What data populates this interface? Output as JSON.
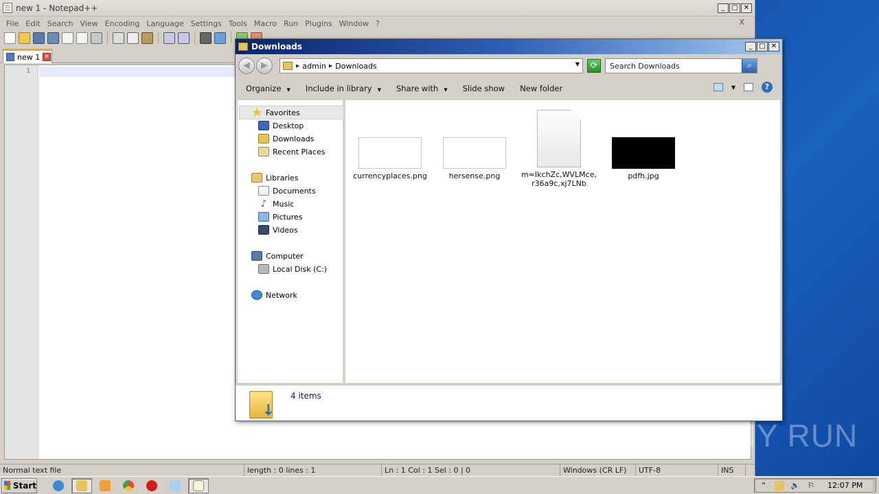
{
  "notepad": {
    "title": "new 1 - Notepad++",
    "caption": {
      "minimize": "_",
      "maximize": "□",
      "close": "✕"
    },
    "menu": [
      "File",
      "Edit",
      "Search",
      "View",
      "Encoding",
      "Language",
      "Settings",
      "Tools",
      "Macro",
      "Run",
      "Plugins",
      "Window",
      "?"
    ],
    "menu_close": "X",
    "tab": {
      "label": "new 1",
      "close": "✕"
    },
    "editor": {
      "line_number": "1"
    },
    "status": {
      "type": "Normal text file",
      "length": "length : 0    lines : 1",
      "position": "Ln : 1    Col : 1    Sel : 0 | 0",
      "eol": "Windows (CR LF)",
      "encoding": "UTF-8",
      "mode": "INS"
    }
  },
  "explorer": {
    "title": "Downloads",
    "caption": {
      "minimize": "_",
      "maximize": "□",
      "close": "✕"
    },
    "nav": {
      "back": "◀",
      "forward": "▶"
    },
    "breadcrumb": [
      "admin",
      "Downloads"
    ],
    "search_placeholder": "Search Downloads",
    "commands": {
      "organize": "Organize",
      "include_in_library": "Include in library",
      "share_with": "Share with",
      "slide_show": "Slide show",
      "new_folder": "New folder"
    },
    "nav_pane": {
      "favorites": "Favorites",
      "desktop": "Desktop",
      "downloads": "Downloads",
      "recent_places": "Recent Places",
      "libraries": "Libraries",
      "documents": "Documents",
      "music": "Music",
      "pictures": "Pictures",
      "videos": "Videos",
      "computer": "Computer",
      "local_disk": "Local Disk (C:)",
      "network": "Network"
    },
    "files": [
      {
        "name": "currencyplaces.png"
      },
      {
        "name": "hersense.png"
      },
      {
        "name_line1": "m=IkchZc,WVLMce,",
        "name_line2": "r36a9c,xj7LNb"
      },
      {
        "name": "pdfh.jpg"
      }
    ],
    "item_count": "4 items"
  },
  "watermark": "ANY RUN",
  "taskbar": {
    "start": "Start",
    "clock": "12:07 PM"
  },
  "colors": {
    "desktop": "#1a5cb8",
    "window_face": "#d4d0c8",
    "explorer_title": "#0a246a",
    "tab_accent": "#f5a623"
  }
}
